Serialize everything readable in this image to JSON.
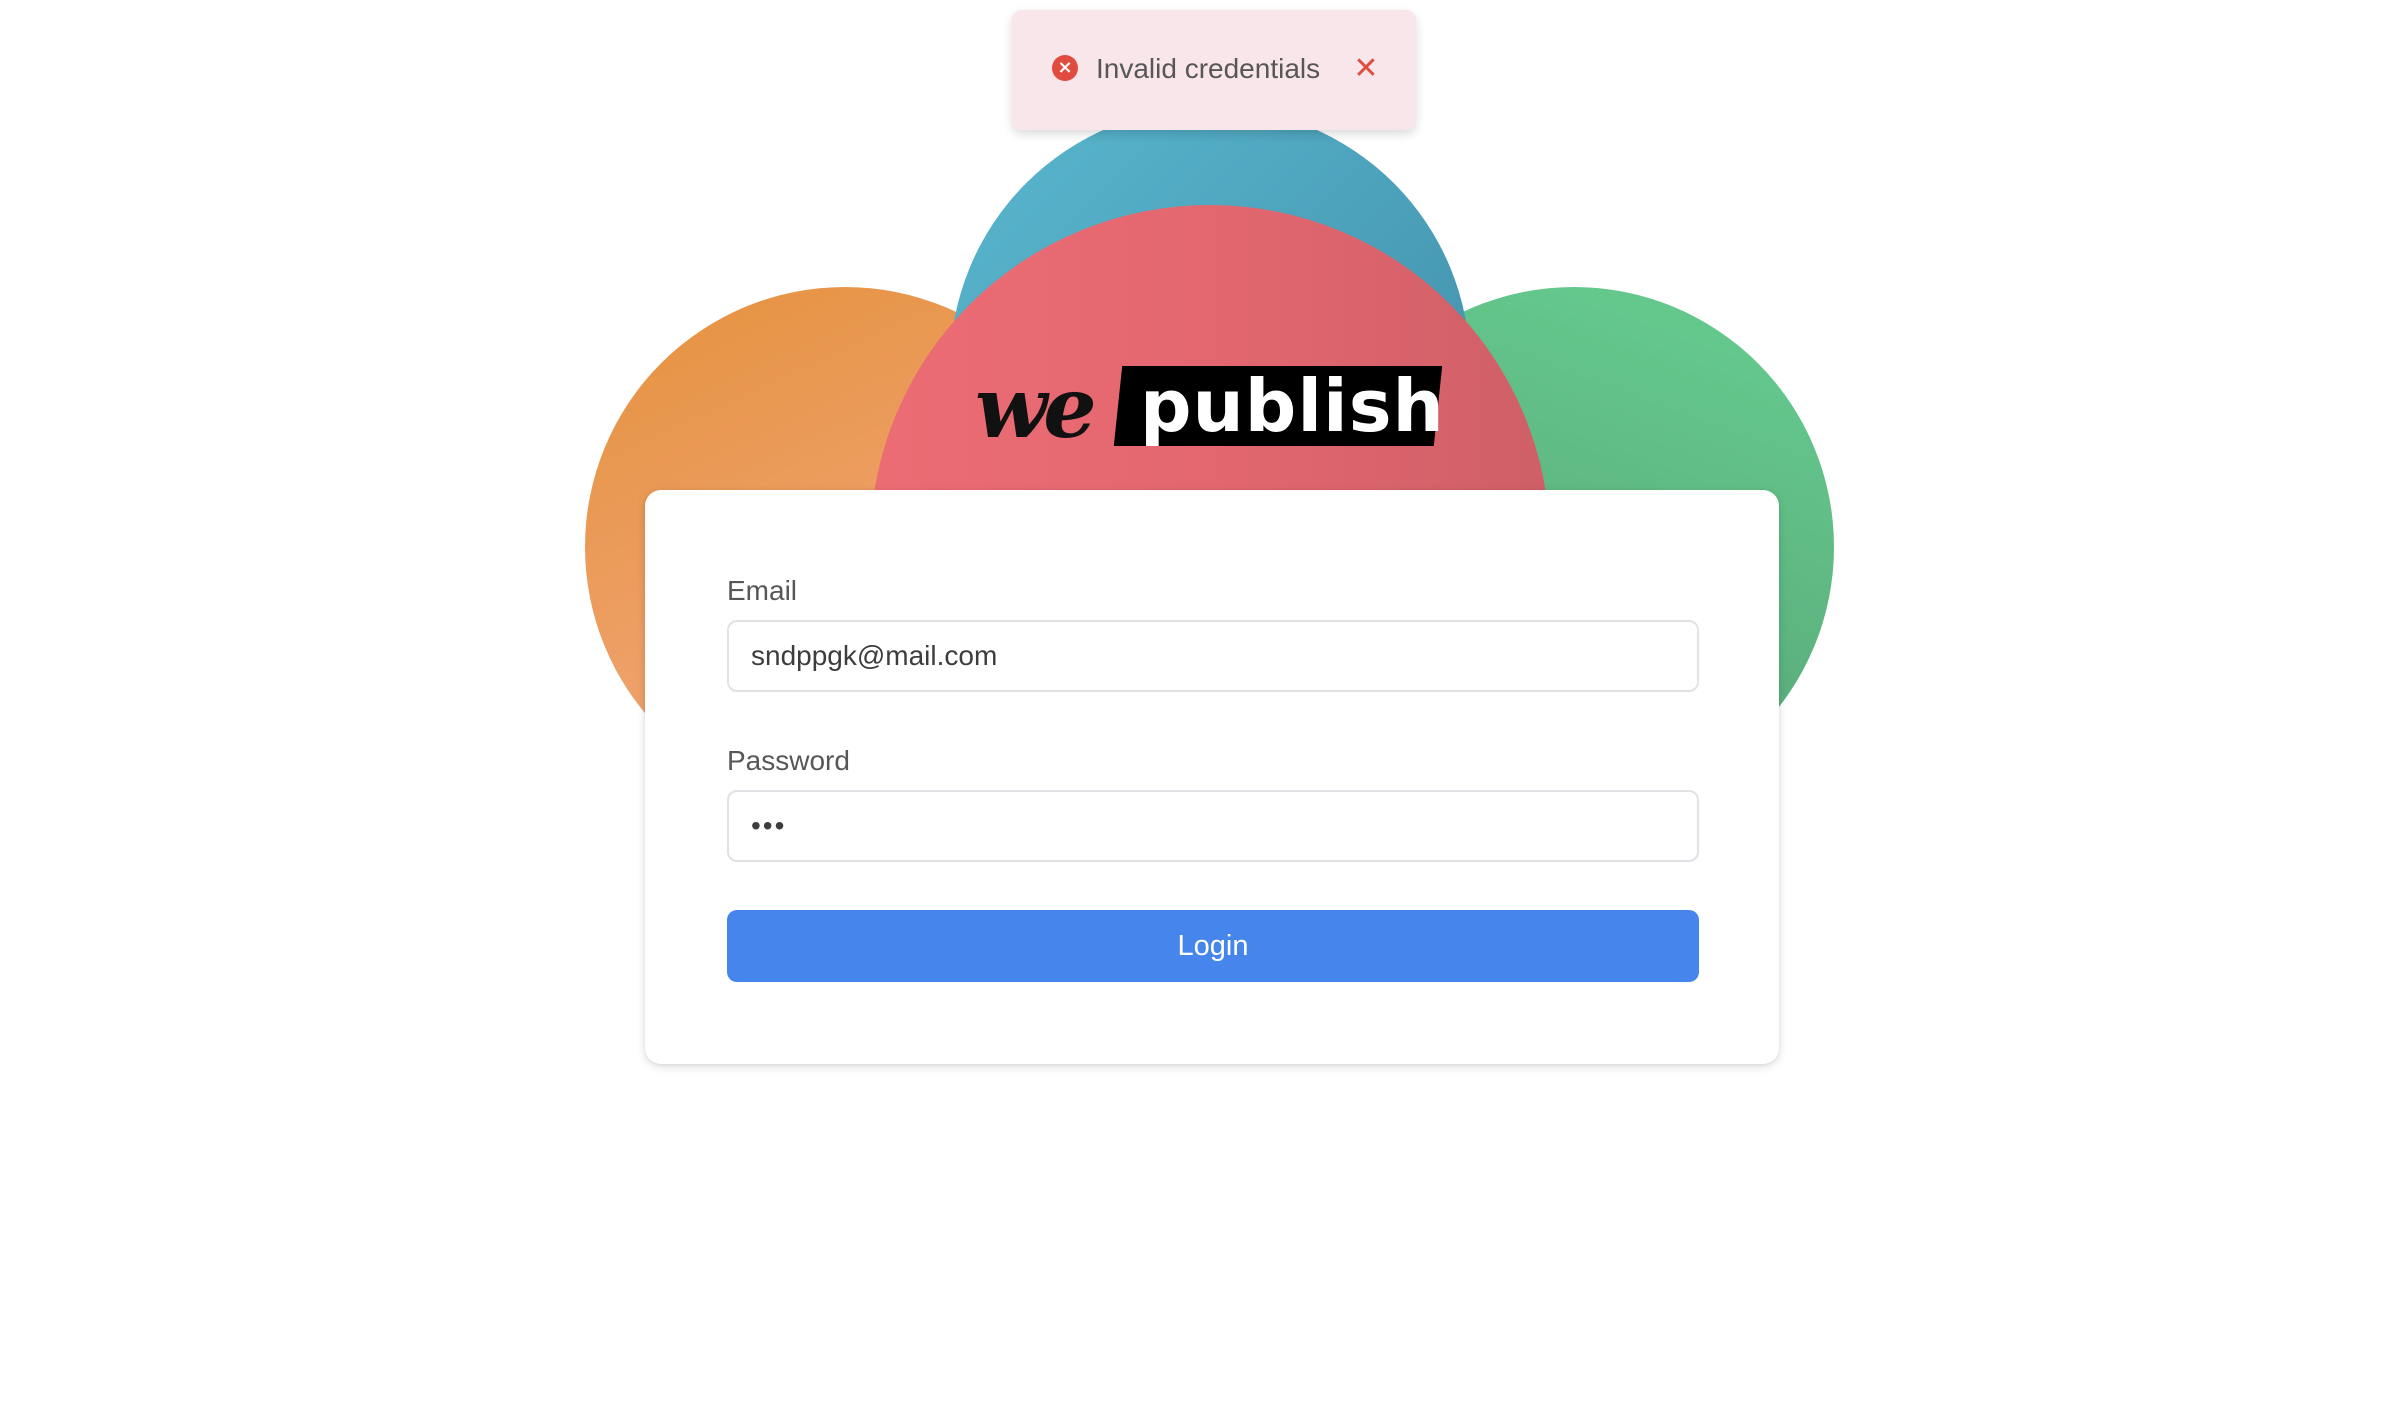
{
  "toast": {
    "type": "error",
    "icon": "error-circle-icon",
    "message": "Invalid credentials",
    "close_icon": "close-icon",
    "close_glyph": "✕",
    "error_glyph": "×"
  },
  "logo": {
    "we": "we",
    "publish": "publish"
  },
  "login_form": {
    "email_label": "Email",
    "email_value": "sndppgk@mail.com",
    "password_label": "Password",
    "password_value": "•••",
    "login_label": "Login"
  },
  "colors": {
    "primary": "#4686ec",
    "error": "#e04c3f",
    "toast_background": "#f9e6ea",
    "circle_orange": "#e5913d",
    "circle_blue": "#4b9fb9",
    "circle_red": "#e3676f",
    "circle_green": "#5fb882"
  }
}
